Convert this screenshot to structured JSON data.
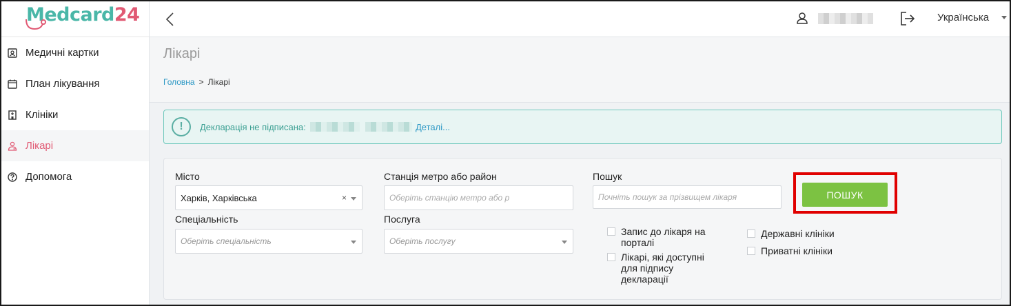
{
  "logo": {
    "m": "M",
    "rest_green": "edcard",
    "rest_red": "24"
  },
  "sidebar": {
    "items": [
      {
        "label": "Медичні картки",
        "icon": "id-card-icon",
        "active": false
      },
      {
        "label": "План лікування",
        "icon": "calendar-icon",
        "active": false
      },
      {
        "label": "Клініки",
        "icon": "hospital-icon",
        "active": false
      },
      {
        "label": "Лікарі",
        "icon": "doctor-icon",
        "active": true
      },
      {
        "label": "Допомога",
        "icon": "help-circle-icon",
        "active": false
      }
    ]
  },
  "topbar": {
    "language": "Українська"
  },
  "page": {
    "title": "Лікарі",
    "breadcrumb": {
      "home": "Головна",
      "separator": ">",
      "current": "Лікарі"
    }
  },
  "alert": {
    "text": "Декларація не підписана:",
    "link": "Деталі..."
  },
  "filters": {
    "city": {
      "label": "Місто",
      "value": "Харків, Харківська",
      "clear": "×"
    },
    "metro": {
      "label": "Станція метро або район",
      "placeholder": "Оберіть станцію метро або р"
    },
    "search": {
      "label": "Пошук",
      "placeholder": "Почніть пошук за прізвищем лікаря"
    },
    "search_button": "ПОШУК",
    "specialty": {
      "label": "Спеціальність",
      "placeholder": "Оберіть спеціальність"
    },
    "service": {
      "label": "Послуга",
      "placeholder": "Оберіть послугу"
    },
    "checkboxes": [
      {
        "label_line1": "Запис до лікаря на",
        "label_line2": "порталі",
        "checked": false
      },
      {
        "label_line1": "Лікарі, які доступні",
        "label_line2": "для підпису",
        "label_line3": "декларації",
        "checked": false
      },
      {
        "label_line1": "Державні клініки",
        "checked": false
      },
      {
        "label_line1": "Приватні клініки",
        "checked": false
      }
    ]
  },
  "colors": {
    "accent_green": "#7cc242",
    "brand_teal": "#4ab7a8",
    "brand_red": "#e15a74",
    "highlight": "#e00000"
  }
}
